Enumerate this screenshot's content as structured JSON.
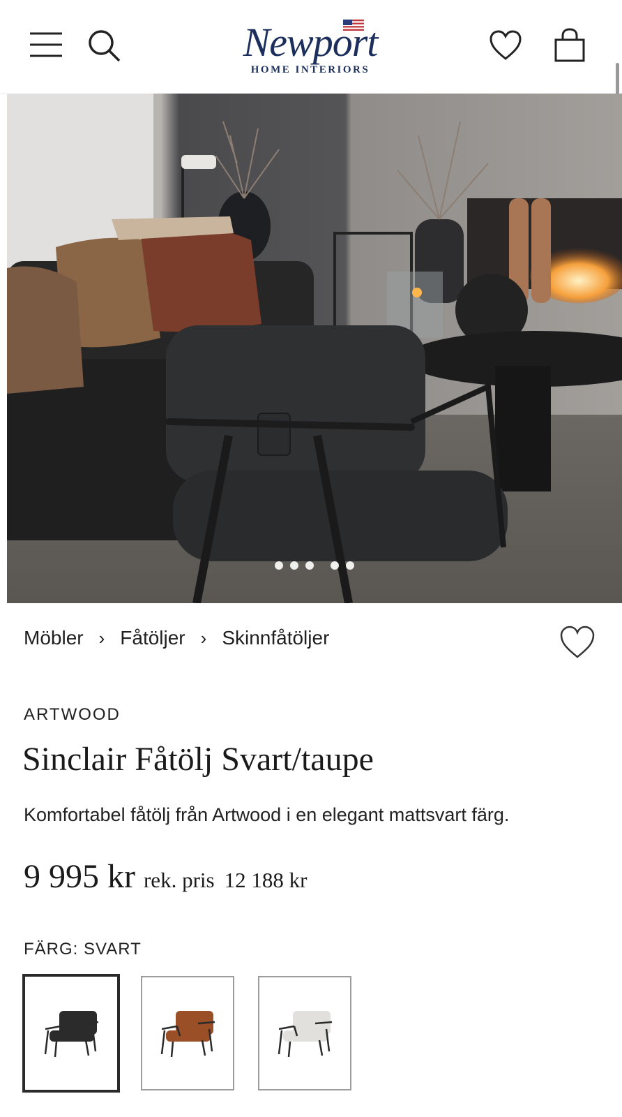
{
  "header": {
    "logo_text": "Newport",
    "logo_tagline": "HOME INTERIORS",
    "icons": [
      "menu-icon",
      "search-icon",
      "heart-icon",
      "shopping-bag-icon"
    ]
  },
  "gallery": {
    "slide_count": 5
  },
  "breadcrumb": {
    "items": [
      "Möbler",
      "Fåtöljer",
      "Skinnfåtöljer"
    ],
    "separator": "›"
  },
  "product": {
    "brand": "ARTWOOD",
    "title": "Sinclair Fåtölj Svart/taupe",
    "description": "Komfortabel fåtölj från Artwood i en elegant mattsvart färg.",
    "price": "9 995 kr",
    "rek_label": "rek. pris",
    "rek_price": "12 188 kr"
  },
  "color_selector": {
    "label": "FÄRG: SVART",
    "options": [
      {
        "color": "#2b2b2b",
        "selected": true
      },
      {
        "color": "#9a4f26",
        "selected": false
      },
      {
        "color": "#e2e0dc",
        "selected": false
      }
    ]
  },
  "colors": {
    "brand_navy": "#1c2f5c",
    "text": "#1b1b1b"
  }
}
